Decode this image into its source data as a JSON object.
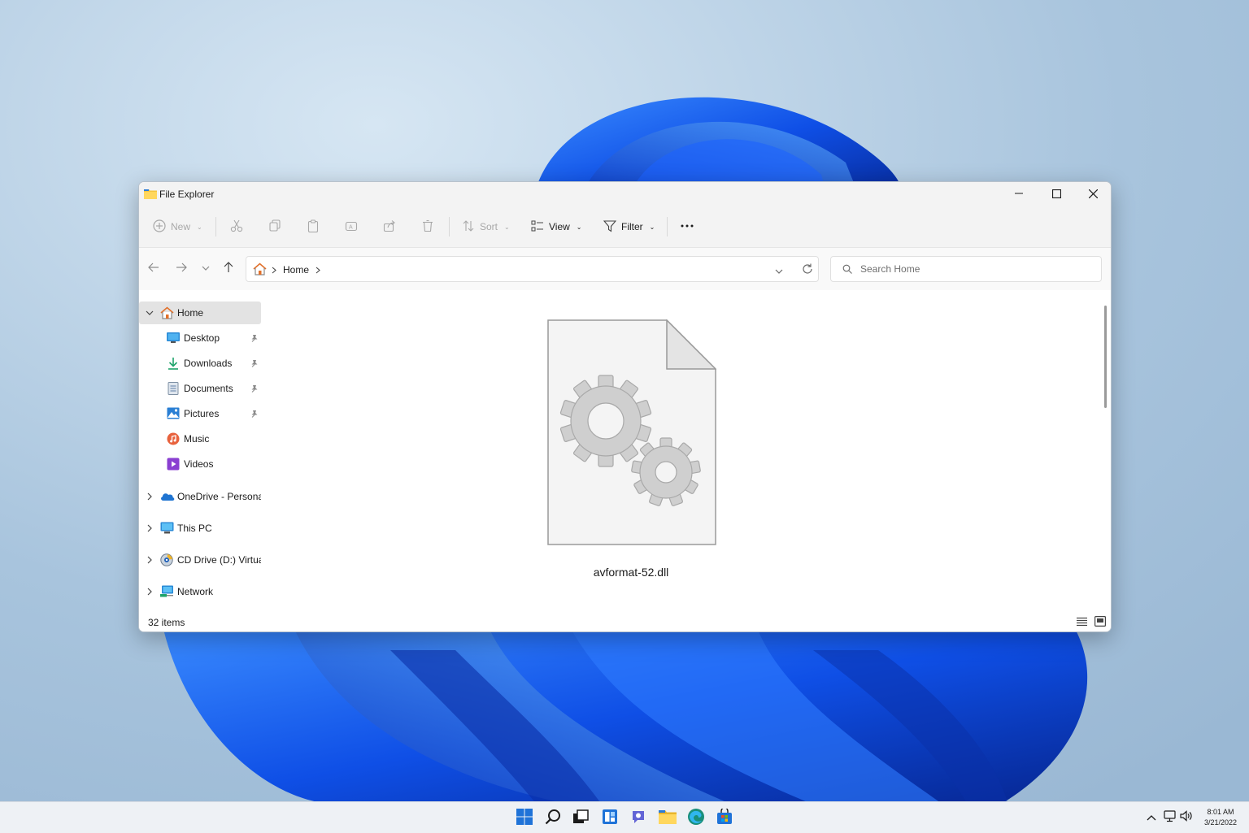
{
  "window": {
    "title": "File Explorer"
  },
  "toolbar": {
    "new_label": "New",
    "sort_label": "Sort",
    "view_label": "View",
    "filter_label": "Filter"
  },
  "address": {
    "crumbs": [
      "Home"
    ],
    "search_placeholder": "Search Home"
  },
  "sidebar": {
    "items": [
      {
        "label": "Home",
        "icon": "home-icon",
        "selected": true
      },
      {
        "label": "Desktop",
        "icon": "desktop-icon",
        "pinned": true
      },
      {
        "label": "Downloads",
        "icon": "downloads-icon",
        "pinned": true
      },
      {
        "label": "Documents",
        "icon": "documents-icon",
        "pinned": true
      },
      {
        "label": "Pictures",
        "icon": "pictures-icon",
        "pinned": true
      },
      {
        "label": "Music",
        "icon": "music-icon"
      },
      {
        "label": "Videos",
        "icon": "videos-icon"
      },
      {
        "label": "OneDrive - Personal",
        "icon": "onedrive-icon"
      },
      {
        "label": "This PC",
        "icon": "this-pc-icon"
      },
      {
        "label": "CD Drive (D:) Virtual",
        "icon": "cd-drive-icon"
      },
      {
        "label": "Network",
        "icon": "network-icon"
      }
    ]
  },
  "content": {
    "files": [
      {
        "name": "avformat-52.dll",
        "icon": "dll-file-icon"
      }
    ]
  },
  "status": {
    "item_count": "32 items"
  },
  "taskbar": {
    "time": "8:01 AM",
    "date": "3/21/2022",
    "apps": [
      "start-icon",
      "search-icon",
      "task-view-icon",
      "widgets-icon",
      "chat-icon",
      "file-explorer-icon",
      "edge-icon",
      "store-icon"
    ]
  },
  "colors": {
    "accent": "#0067c0",
    "wallpaper_bloom": "#1a5cff",
    "window_chrome": "#f3f3f3"
  }
}
